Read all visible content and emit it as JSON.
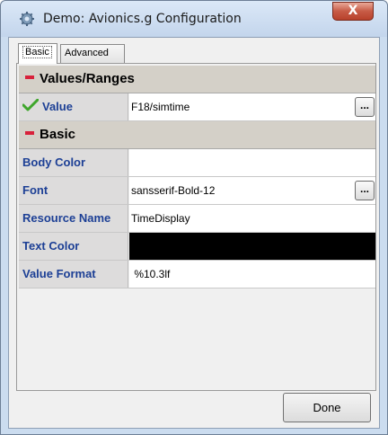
{
  "window": {
    "title": "Demo: Avionics.g Configuration",
    "close_glyph": "X"
  },
  "tabs": [
    {
      "label": "Basic",
      "active": true
    },
    {
      "label": "Advanced",
      "active": false
    }
  ],
  "sections": [
    {
      "title": "Values/Ranges",
      "rows": [
        {
          "name": "Value",
          "value": "F18/simtime",
          "has_check": true,
          "has_ellipsis": true
        }
      ]
    },
    {
      "title": "Basic",
      "rows": [
        {
          "name": "Body Color",
          "value": ""
        },
        {
          "name": "Font",
          "value": "sansserif-Bold-12",
          "has_ellipsis": true
        },
        {
          "name": "Resource Name",
          "value": "TimeDisplay"
        },
        {
          "name": "Text Color",
          "value": "",
          "color": "#000000"
        },
        {
          "name": "Value Format",
          "value": " %10.3lf"
        }
      ]
    }
  ],
  "ellipsis_label": "...",
  "done_label": "Done",
  "icons": {
    "app": "gear-icon",
    "collapse": "minus-icon",
    "check": "checkmark-icon"
  },
  "colors": {
    "property_name": "#1c3f95",
    "collapse": "#d8213b",
    "check": "#3fa62c"
  }
}
